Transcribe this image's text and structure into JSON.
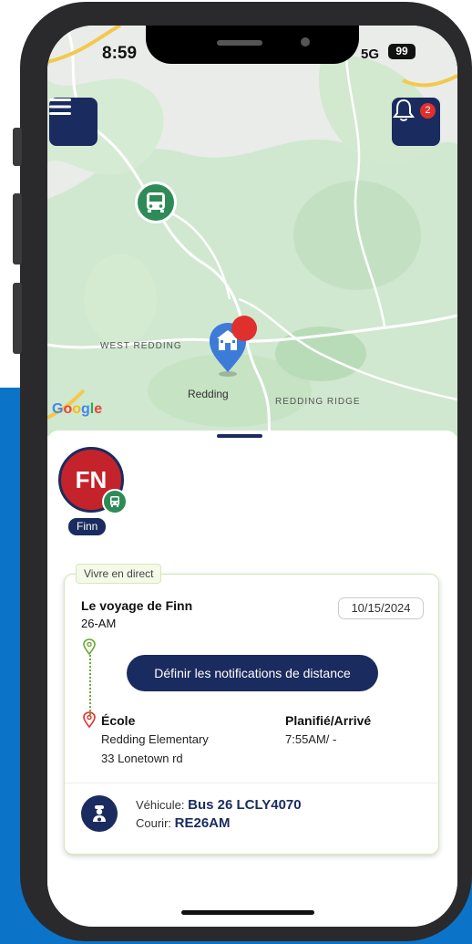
{
  "status": {
    "time": "8:59",
    "network": "5G",
    "battery": "99"
  },
  "map": {
    "labels": {
      "west_redding": "WEST REDDING",
      "redding": "Redding",
      "redding_ridge": "REDDING RIDGE"
    },
    "google": "Google"
  },
  "notifications": {
    "count": "2"
  },
  "student": {
    "initials": "FN",
    "name": "Finn"
  },
  "trip": {
    "live_tag": "Vivre en direct",
    "title": "Le voyage de Finn",
    "code": "26-AM",
    "date": "10/15/2024",
    "notif_button": "Définir les notifications de distance",
    "school_heading": "École",
    "school_name": "Redding Elementary",
    "school_address": "33 Lonetown rd",
    "schedule_heading": "Planifié/Arrivé",
    "schedule_value": "7:55AM/ -",
    "vehicle_label": "Véhicule:",
    "vehicle_value": "Bus 26 LCLY4070",
    "courier_label": "Courir:",
    "courier_value": "RE26AM"
  },
  "colors": {
    "navy": "#1a2b5f",
    "accent_blue": "#0b74c9",
    "bus_green": "#2e8b57",
    "alert_red": "#e0302d"
  }
}
